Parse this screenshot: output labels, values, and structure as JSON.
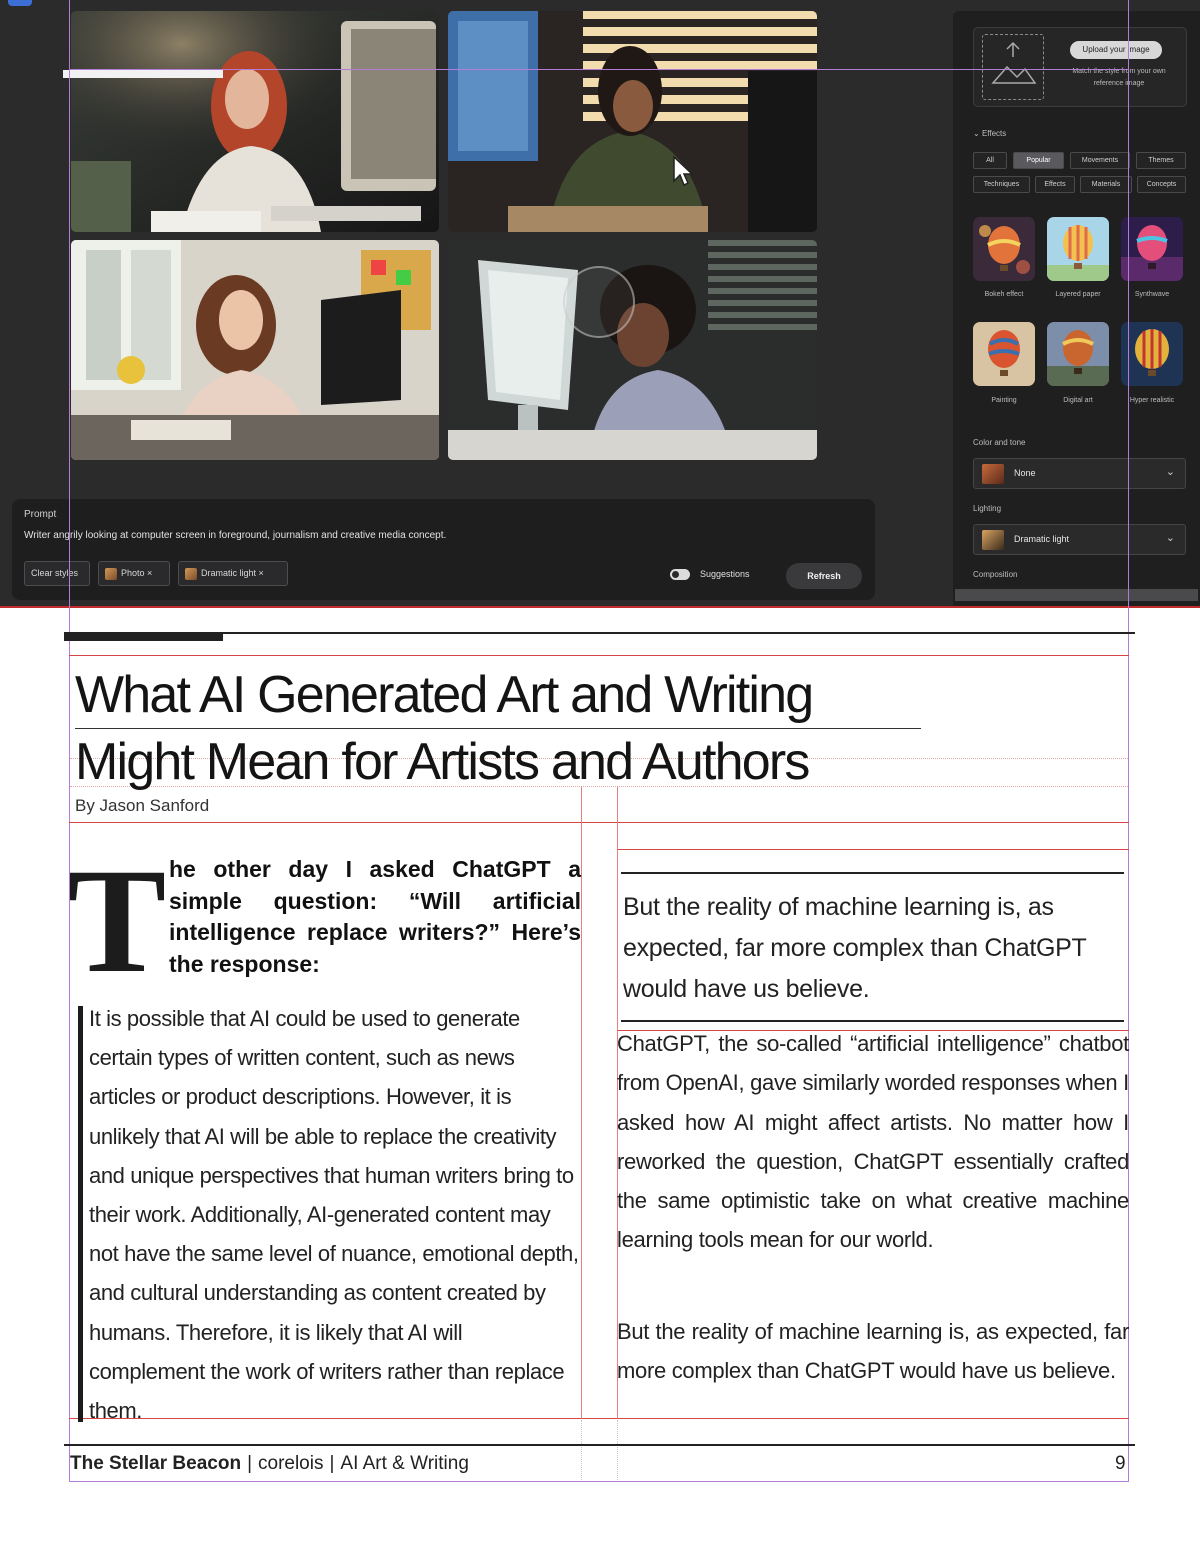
{
  "screenshot": {
    "prompt_title": "Prompt",
    "prompt_text": "Writer angrily looking at computer screen in foreground, journalism and creative media concept.",
    "chips": [
      "Clear styles",
      "Photo ×",
      "Dramatic light ×"
    ],
    "suggestions_label": "Suggestions",
    "refresh_label": "Refresh",
    "upload_button": "Upload your image",
    "upload_hint": "Match the style from your own reference image",
    "effects_label": "Effects",
    "filter_tabs": [
      "All",
      "Popular",
      "Movements",
      "Themes",
      "Techniques",
      "Effects",
      "Materials",
      "Concepts"
    ],
    "effect_thumbs": [
      "Bokeh effect",
      "Layered paper",
      "Synthwave",
      "Painting",
      "Digital art",
      "Hyper realistic"
    ],
    "color_tone_label": "Color and tone",
    "color_tone_value": "None",
    "lighting_label": "Lighting",
    "lighting_value": "Dramatic light",
    "composition_label": "Composition"
  },
  "article": {
    "headline_line1": "What AI Generated Art and Writing",
    "headline_line2": "Might Mean for Artists and Authors",
    "byline": "By Jason Sanford",
    "dropcap": "T",
    "lead": "he other day I asked ChatGPT a simple question: “Will artificial intelligence replace writers?” Here’s the response:",
    "quote": "It is possible that AI could be used to generate certain types of written content, such as news articles or product descriptions. However, it is unlikely that AI will be able to replace the creativity and unique perspectives that human writers bring to their work. Additionally, AI-generated content may not have the same level of nuance, emotional depth, and cultural understanding as content created by humans. Therefore, it is likely that AI will complement the work of writers rather than replace them.",
    "pullquote": "But the reality of machine learning is, as expected, far more complex than ChatGPT would have us believe.",
    "body_p1": "ChatGPT, the so-called “artificial intelligence” chatbot from OpenAI, gave similarly worded responses when I asked how AI might affect artists. No matter how I reworked the question, ChatGPT essentially crafted the same optimistic take on what creative machine learning tools mean for our world.",
    "body_p2": "But the reality of machine learning is, as expected, far more complex than ChatGPT would have us believe."
  },
  "footer": {
    "publication": "The Stellar Beacon",
    "author": "corelois",
    "section": "AI Art & Writing",
    "page_number": "9"
  },
  "colors": {
    "app_background": "#2b2b2c",
    "panel_background": "#1f1f20",
    "guide_purple": "#b57bd8",
    "guide_red": "#d64545",
    "ink": "#1a1a1a"
  }
}
